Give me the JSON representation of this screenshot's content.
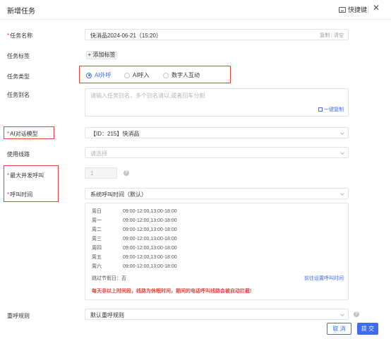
{
  "header": {
    "title": "新增任务",
    "shortcut_label": "快捷键",
    "close_glyph": "✕"
  },
  "task_name": {
    "label": "任务名称",
    "value": "快消品2024-06-21（15:20）",
    "copy_label": "复制",
    "clear_label": "清空",
    "required": true
  },
  "task_tags": {
    "label": "任务标签",
    "add_label": "+ 添加标签"
  },
  "task_type": {
    "label": "任务类型",
    "options": [
      {
        "label": "AI外呼",
        "selected": true
      },
      {
        "label": "AI呼入",
        "selected": false
      },
      {
        "label": "数字人互动",
        "selected": false
      }
    ]
  },
  "task_alias": {
    "label": "任务别名",
    "placeholder": "请输入任务别名，多个别名请以,或者回车分割",
    "copy_label": "一键复制"
  },
  "ai_model": {
    "label": "AI对话模型",
    "value": "【ID：215】快消品",
    "required": true
  },
  "line": {
    "label": "使用线路",
    "placeholder": "请选择"
  },
  "max_concurrency": {
    "label": "最大并发呼叫",
    "value": "1",
    "required": true
  },
  "call_time": {
    "label": "呼叫时间",
    "value": "系统呼叫时间（默认）",
    "required": true,
    "schedule": [
      {
        "day": "周日",
        "time": "09:00-12:00,13:00-18:00"
      },
      {
        "day": "周一",
        "time": "09:00-12:00,13:00-18:00"
      },
      {
        "day": "周二",
        "time": "09:00-12:00,13:00-18:00"
      },
      {
        "day": "周三",
        "time": "09:00-12:00,13:00-18:00"
      },
      {
        "day": "周四",
        "time": "09:00-12:00,13:00-18:00"
      },
      {
        "day": "周五",
        "time": "09:00-12:00,13:00-18:00"
      },
      {
        "day": "周六",
        "time": "09:00-12:00,13:00-18:00"
      }
    ],
    "skip_holiday": "跳过节假日：否",
    "goto_settings": "前往设置呼叫时间",
    "warning": "每天非以上时间段，线路为休眠时间，期间的电话呼叫线路会被自动拦截!"
  },
  "redial": {
    "label": "重呼规则",
    "value": "默认重呼规则"
  },
  "footer": {
    "cancel_label": "取 消",
    "submit_label": "提 交"
  },
  "colors": {
    "primary": "#3e6bef",
    "required": "#e8413a"
  }
}
